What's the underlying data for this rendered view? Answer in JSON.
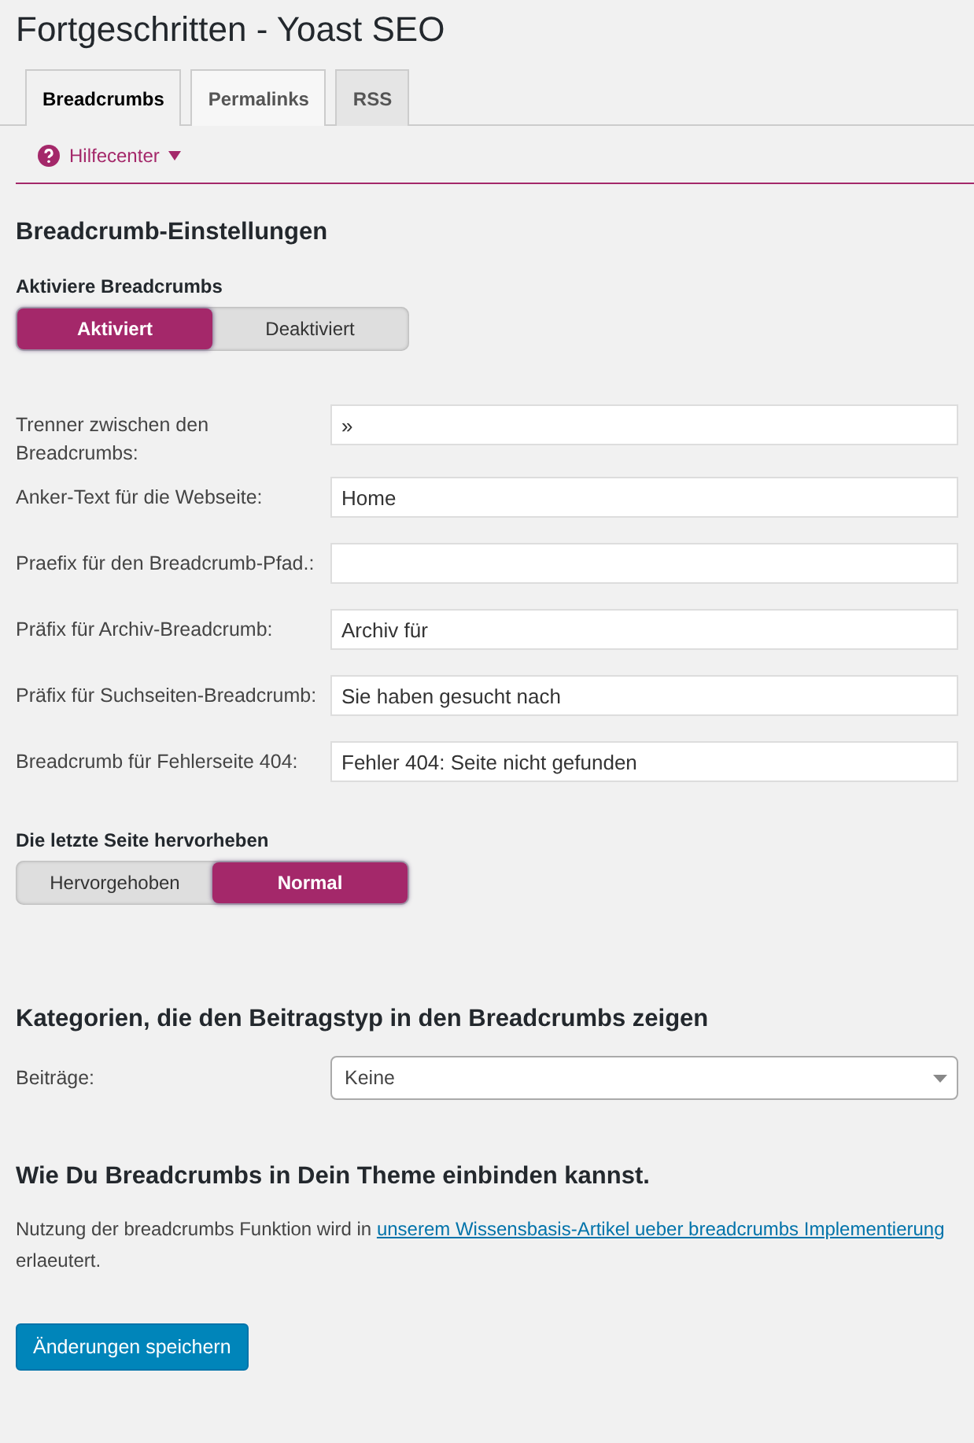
{
  "title": "Fortgeschritten - Yoast SEO",
  "tabs": [
    {
      "label": "Breadcrumbs",
      "selected": true
    },
    {
      "label": "Permalinks",
      "selected": false
    },
    {
      "label": "RSS",
      "selected": false
    }
  ],
  "help": {
    "label": "Hilfecenter",
    "expanded": false
  },
  "settings": {
    "heading": "Breadcrumb-Einstellungen",
    "enable": {
      "label": "Aktiviere Breadcrumbs",
      "options": [
        {
          "label": "Aktiviert",
          "selected": true
        },
        {
          "label": "Deaktiviert",
          "selected": false
        }
      ]
    },
    "fields": [
      {
        "label": "Trenner zwischen den Breadcrumbs:",
        "value": "»"
      },
      {
        "label": "Anker-Text für die Webseite:",
        "value": "Home"
      },
      {
        "label": "Praefix für den Breadcrumb-Pfad.:"
      },
      {
        "label": "Präfix für Archiv-Breadcrumb:",
        "value": "Archiv für"
      },
      {
        "label": "Präfix für Suchseiten-Breadcrumb:",
        "value": "Sie haben gesucht nach"
      },
      {
        "label": "Breadcrumb für Fehlerseite 404:",
        "value": "Fehler 404: Seite nicht gefunden"
      }
    ],
    "highlight": {
      "label": "Die letzte Seite hervorheben",
      "options": [
        {
          "label": "Hervorgehoben",
          "selected": false
        },
        {
          "label": "Normal",
          "selected": true
        }
      ]
    }
  },
  "taxonomy": {
    "heading": "Kategorien, die den Beitragstyp in den Breadcrumbs zeigen",
    "select": {
      "label": "Beiträge:",
      "value": "Keine"
    }
  },
  "howto": {
    "heading": "Wie Du Breadcrumbs in Dein Theme einbinden kannst.",
    "text_before": "Nutzung der breadcrumbs Funktion wird in",
    "link": "unserem Wissensbasis-Artikel ueber breadcrumbs Implementierung",
    "text_after": "erlaeutert."
  },
  "save_button": "Änderungen speichern"
}
